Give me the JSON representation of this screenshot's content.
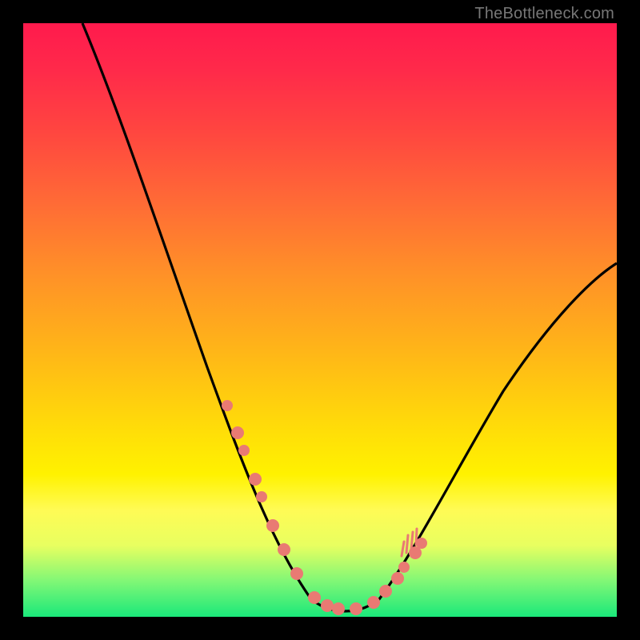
{
  "watermark": "TheBottleneck.com",
  "chart_data": {
    "type": "line",
    "title": "",
    "xlabel": "",
    "ylabel": "",
    "xlim": [
      0,
      100
    ],
    "ylim": [
      0,
      100
    ],
    "series": [
      {
        "name": "bottleneck-curve",
        "x": [
          10,
          15,
          20,
          25,
          30,
          33,
          36,
          39,
          42,
          45,
          48,
          51,
          54,
          58,
          62,
          66,
          70,
          75,
          80,
          85,
          90,
          95,
          100
        ],
        "y": [
          100,
          90,
          78,
          66,
          50,
          40,
          30,
          22,
          14,
          8,
          4,
          2,
          1,
          1,
          3,
          7,
          12,
          19,
          27,
          35,
          43,
          50,
          57
        ]
      }
    ],
    "markers": {
      "name": "highlight-dots",
      "x": [
        34,
        36,
        37,
        39,
        40,
        42,
        44,
        46,
        49,
        51,
        53,
        56,
        59,
        61,
        63,
        64,
        66,
        67
      ],
      "y": [
        36,
        31,
        28,
        23,
        20,
        15,
        11,
        7,
        3,
        2,
        1,
        1,
        2,
        4,
        6,
        8,
        10,
        12
      ],
      "note": "approximate positions of salmon dots along the valley; y is % from bottom"
    },
    "colors": {
      "curve": "#000000",
      "markers": "#e97a73",
      "gradient_top": "#ff1a4d",
      "gradient_bottom": "#1ae87a"
    }
  }
}
